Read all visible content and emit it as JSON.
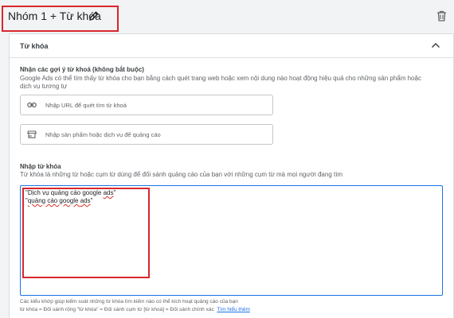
{
  "group": {
    "title": "Nhóm 1 + Từ khóa"
  },
  "card": {
    "title": "Từ khóa"
  },
  "suggestions": {
    "title": "Nhận các gợi ý từ khoá (không bắt buộc)",
    "description": "Google Ads có thể tìm thấy từ khóa cho bạn bằng cách quét trang web hoặc xem nội dung nào hoạt động hiệu quả cho những sản phẩm hoặc dịch vụ tương tự",
    "url_placeholder": "Nhập URL để quét tìm từ khoá",
    "product_placeholder": "Nhập sản phẩm hoặc dịch vụ để quảng cáo"
  },
  "keywords": {
    "title": "Nhập từ khóa",
    "description": "Từ khóa là những từ hoặc cụm từ dùng để đối sánh quảng cáo của bạn với những cụm từ mà mọi người đang tìm",
    "line1_prefix": "\"Dịch vụ quảng cáo google ",
    "line1_word": "ads",
    "line1_suffix": "\"",
    "line2_prefix": "\"",
    "line2_mid": "quảng cáo google ",
    "line2_word": "ads",
    "line2_suffix": "\""
  },
  "footer": {
    "line1": "Các kiểu khớp giúp kiểm soát những từ khóa tìm kiếm nào có thể kích hoạt quảng cáo của bạn",
    "line2": "từ khóa = Đối sánh rộng  \"từ khóa\" = Đối sánh cụm từ  [từ khoá] = Đối sánh chính xác",
    "learn_more": "Tìm hiểu thêm"
  },
  "icons": {
    "pencil": "pencil-icon",
    "trash": "trash-icon",
    "chevron": "chevron-up-icon",
    "link": "link-icon",
    "store": "store-icon"
  },
  "colors": {
    "highlight": "#d9262c",
    "focus": "#1a73e8"
  }
}
